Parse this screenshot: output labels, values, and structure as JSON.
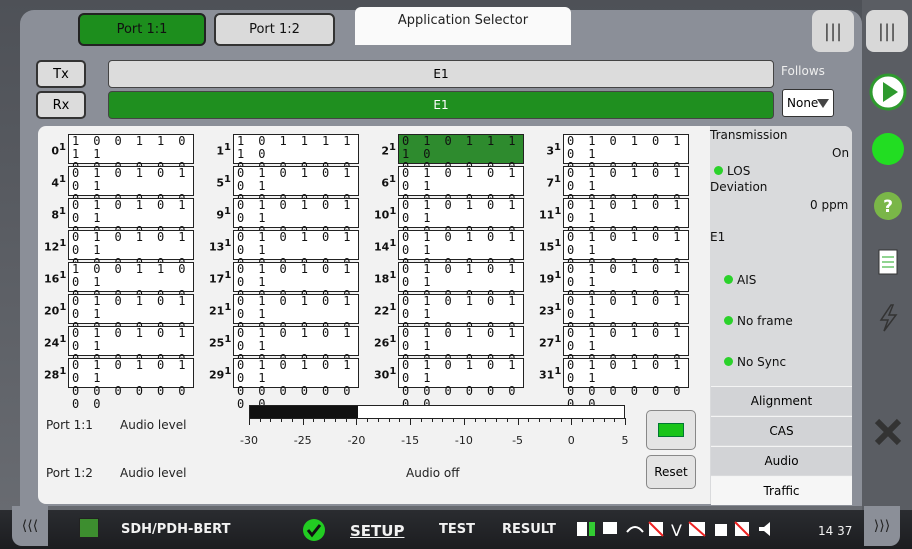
{
  "ports": {
    "p1": "Port 1:1",
    "p2": "Port 1:2"
  },
  "app_selector": "Application Selector",
  "top_icons": {
    "a": "|||",
    "b": "|||"
  },
  "tx": {
    "label": "Tx",
    "signal": "E1"
  },
  "rx": {
    "label": "Rx",
    "signal": "E1"
  },
  "follows": {
    "label": "Follows",
    "value": "None"
  },
  "timeslots": [
    {
      "n": "0",
      "top": "1 0 0 1 1 0 1 1",
      "bot": "0 0 0 0 0 0 0 0"
    },
    {
      "n": "1",
      "top": "1 0 1 1 1 1 1 0",
      "bot": "0 0 0 0 0 0 0 0"
    },
    {
      "n": "2",
      "top": "0 1 0 1 1 1 1 0",
      "bot": "0 0 0 0 0 0 0 0",
      "hl": true
    },
    {
      "n": "3",
      "top": "0 1 0 1 0 1 0 1",
      "bot": "0 0 0 0 0 0 0 0"
    },
    {
      "n": "4",
      "top": "0 1 0 1 0 1 0 1",
      "bot": "0 0 0 0 0 0 0 0"
    },
    {
      "n": "5",
      "top": "0 1 0 1 0 1 0 1",
      "bot": "0 0 0 0 0 0 0 0"
    },
    {
      "n": "6",
      "top": "0 1 0 1 0 1 0 1",
      "bot": "0 0 0 0 0 0 0 0"
    },
    {
      "n": "7",
      "top": "0 1 0 1 0 1 0 1",
      "bot": "0 0 0 0 0 0 0 0"
    },
    {
      "n": "8",
      "top": "0 1 0 1 0 1 0 1",
      "bot": "0 0 0 0 0 0 0 0"
    },
    {
      "n": "9",
      "top": "0 1 0 1 0 1 0 1",
      "bot": "0 0 0 0 0 0 0 0"
    },
    {
      "n": "10",
      "top": "0 1 0 1 0 1 0 1",
      "bot": "0 0 0 0 0 0 0 0"
    },
    {
      "n": "11",
      "top": "0 1 0 1 0 1 0 1",
      "bot": "0 0 0 0 0 0 0 0"
    },
    {
      "n": "12",
      "top": "0 1 0 1 0 1 0 1",
      "bot": "0 0 0 0 0 0 0 0"
    },
    {
      "n": "13",
      "top": "0 1 0 1 0 1 0 1",
      "bot": "0 0 0 0 0 0 0 0"
    },
    {
      "n": "14",
      "top": "0 1 0 1 0 1 0 1",
      "bot": "0 0 0 0 0 0 0 0"
    },
    {
      "n": "15",
      "top": "0 1 0 1 0 1 0 1",
      "bot": "0 0 0 0 0 0 0 0"
    },
    {
      "n": "16",
      "top": "1 0 0 1 1 0 0 1",
      "bot": "0 0 0 0 0 0 0 0"
    },
    {
      "n": "17",
      "top": "0 1 0 1 0 1 0 1",
      "bot": "0 0 0 0 0 0 0 0"
    },
    {
      "n": "18",
      "top": "0 1 0 1 0 1 0 1",
      "bot": "0 0 0 0 0 0 0 0"
    },
    {
      "n": "19",
      "top": "0 1 0 1 0 1 0 1",
      "bot": "0 0 0 0 0 0 0 0"
    },
    {
      "n": "20",
      "top": "0 1 0 1 0 1 0 1",
      "bot": "0 0 0 0 0 0 0 0"
    },
    {
      "n": "21",
      "top": "0 1 0 1 0 1 0 1",
      "bot": "0 0 0 0 0 0 0 0"
    },
    {
      "n": "22",
      "top": "0 1 0 1 0 1 0 1",
      "bot": "0 0 0 0 0 0 0 0"
    },
    {
      "n": "23",
      "top": "0 1 0 1 0 1 0 1",
      "bot": "0 0 0 0 0 0 0 0"
    },
    {
      "n": "24",
      "top": "0 1 0 1 0 1 0 1",
      "bot": "0 0 0 0 0 0 0 0"
    },
    {
      "n": "25",
      "top": "0 1 0 1 0 1 0 1",
      "bot": "0 0 0 0 0 0 0 0"
    },
    {
      "n": "26",
      "top": "0 1 0 1 0 1 0 1",
      "bot": "0 0 0 0 0 0 0 0"
    },
    {
      "n": "27",
      "top": "0 1 0 1 0 1 0 1",
      "bot": "0 0 0 0 0 0 0 0"
    },
    {
      "n": "28",
      "top": "0 1 0 1 0 1 0 1",
      "bot": "0 0 0 0 0 0 0 0"
    },
    {
      "n": "29",
      "top": "0 1 0 1 0 1 0 1",
      "bot": "0 0 0 0 0 0 0 0"
    },
    {
      "n": "30",
      "top": "0 1 0 1 0 1 0 1",
      "bot": "0 0 0 0 0 0 0 0"
    },
    {
      "n": "31",
      "top": "0 1 0 1 0 1 0 1",
      "bot": "0 0 0 0 0 0 0 0"
    }
  ],
  "status": {
    "transmission": "Transmission",
    "transmission_val": "On",
    "los": "LOS",
    "deviation": "Deviation",
    "deviation_val": "0 ppm",
    "e1": "E1",
    "ais": "AIS",
    "noframe": "No frame",
    "nosync": "No Sync",
    "led_color": "#2bd22b"
  },
  "side_tabs": [
    "Alignment",
    "CAS",
    "Audio",
    "Traffic"
  ],
  "audio": {
    "p1": "Port 1:1",
    "p1_label": "Audio level",
    "p2": "Port 1:2",
    "p2_label": "Audio level",
    "p2_value": "Audio off",
    "level_fraction": 0.29,
    "scale": [
      "-30",
      "-25",
      "-20",
      "-15",
      "-10",
      "-5",
      "0",
      "5"
    ],
    "reset": "Reset"
  },
  "taskbar": {
    "app": "SDH/PDH-BERT",
    "setup": "SETUP",
    "test": "TEST",
    "result": "RESULT",
    "time": "14 37"
  },
  "nav": {
    "left": "⟨⟨⟨",
    "right": "⟩⟩⟩"
  }
}
